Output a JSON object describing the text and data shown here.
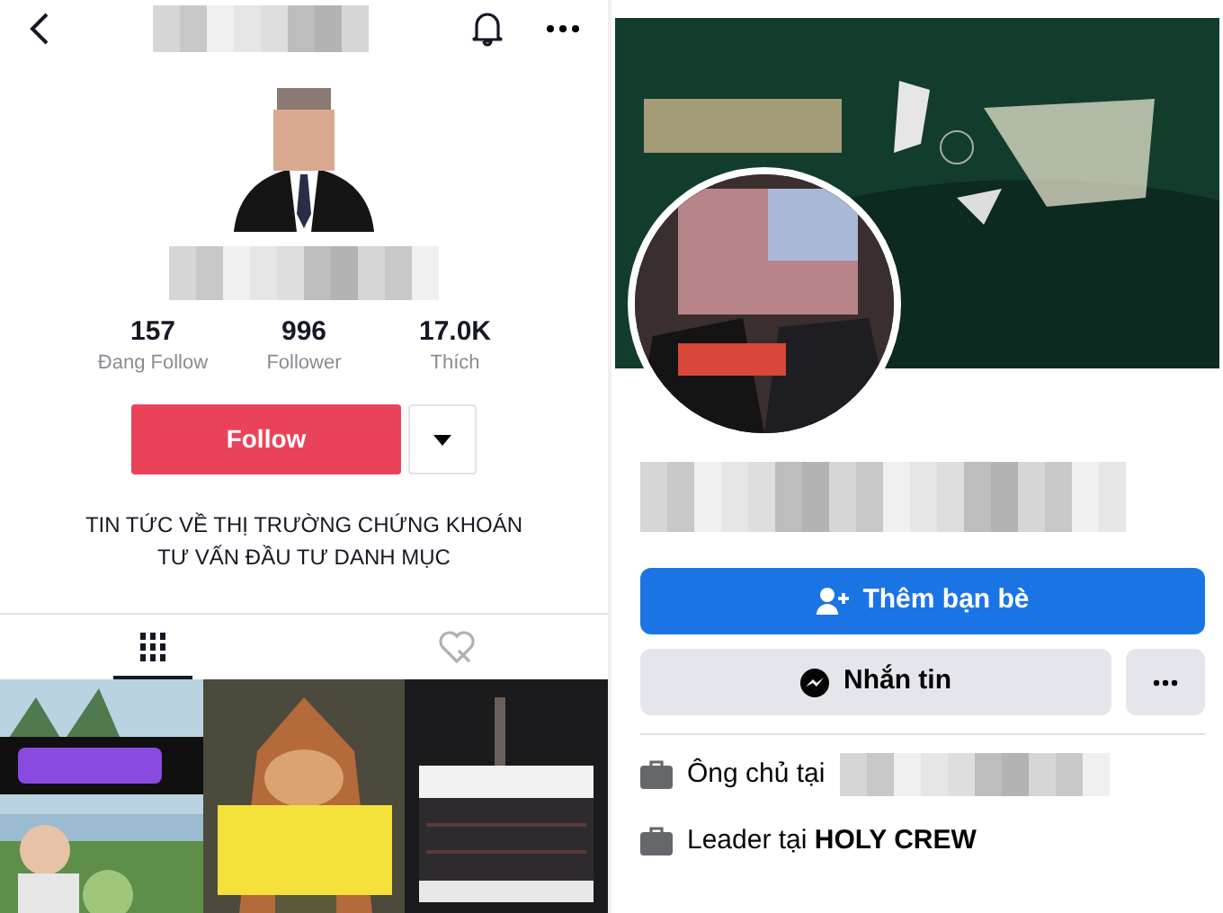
{
  "tiktok": {
    "stats": [
      {
        "value": "157",
        "label": "Đang Follow"
      },
      {
        "value": "996",
        "label": "Follower"
      },
      {
        "value": "17.0K",
        "label": "Thích"
      }
    ],
    "follow_button": "Follow",
    "bio": [
      "TIN TỨC VỀ THỊ TRƯỜNG CHỨNG KHOÁN",
      "TƯ VẤN ĐẦU TƯ DANH MỤC"
    ],
    "tabs": [
      {
        "kind": "videos",
        "selected": true
      },
      {
        "kind": "liked",
        "selected": false
      }
    ],
    "videos": [
      {
        "kind": "picture"
      },
      {
        "kind": "picture"
      },
      {
        "kind": "picture"
      }
    ]
  },
  "facebook": {
    "add_friend_button": "Thêm bạn bè",
    "message_button": "Nhắn tin",
    "details": [
      {
        "kind": "work",
        "text": "Ông chủ tại"
      },
      {
        "kind": "work",
        "text": "Leader tại **HOLY CREW**"
      }
    ]
  }
}
